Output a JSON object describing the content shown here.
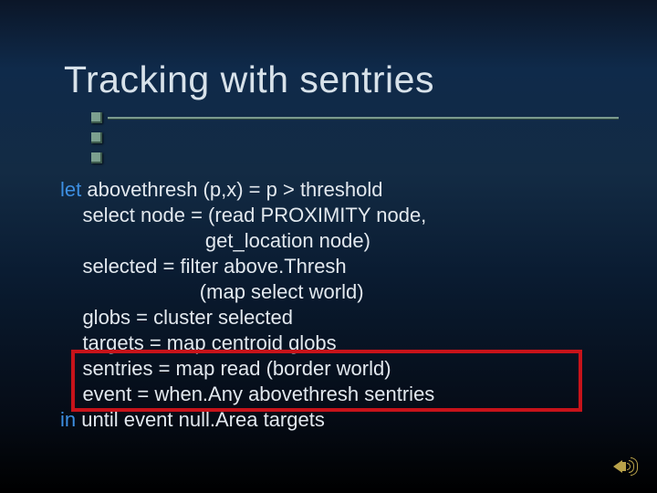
{
  "title": "Tracking with sentries",
  "code": {
    "kw_let": "let",
    "l1_rest": " abovethresh (p,x) = p > threshold",
    "l2": "    select node = (read PROXIMITY node,",
    "l3": "                          get_location node)",
    "l4": "    selected = filter above.Thresh",
    "l5": "                         (map select world)",
    "l6": "    globs = cluster selected",
    "l7": "    targets = map centroid globs",
    "l8": "    sentries = map read (border world)",
    "l9": "    event = when.Any abovethresh sentries",
    "kw_in": "in",
    "l10_rest": " until event null.Area targets"
  }
}
